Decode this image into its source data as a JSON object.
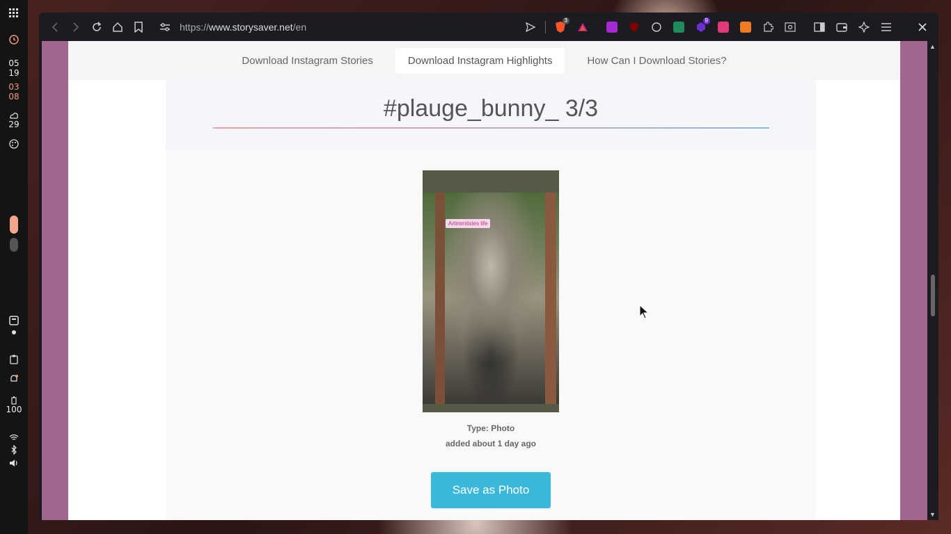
{
  "system_rail": {
    "time_hour": "05",
    "time_minute": "19",
    "date_month": "03",
    "date_day": "08",
    "weather_temp": "29",
    "battery_level": "100"
  },
  "browser": {
    "url_scheme": "https://",
    "url_host": "www.storysaver.net",
    "url_path": "/en",
    "brave_badge": "3",
    "ext_badge": "9"
  },
  "nav": {
    "tabs": [
      {
        "label": "Download Instagram Stories",
        "active": false
      },
      {
        "label": "Download Instagram Highlights",
        "active": true
      },
      {
        "label": "How Can I Download Stories?",
        "active": false
      }
    ]
  },
  "story": {
    "title": "#plauge_bunny_ 3/3",
    "sticker_text": "Artimmitstes life",
    "type_label": "Type: Photo",
    "added_label": "added about 1 day ago",
    "save_button": "Save as Photo"
  },
  "colors": {
    "accent_button": "#3bb8d9",
    "page_bg": "#a2678f"
  }
}
